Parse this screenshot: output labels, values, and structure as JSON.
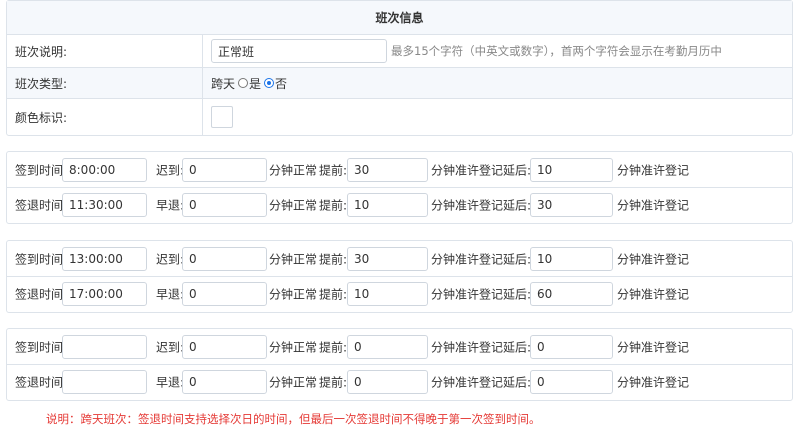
{
  "info": {
    "title": "班次信息",
    "name_label": "班次说明:",
    "name_value": "正常班",
    "name_hint": "最多15个字符（中英文或数字），首两个字符会显示在考勤月历中",
    "type_label": "班次类型:",
    "overnight_label": "跨天",
    "option_yes": "是",
    "option_no": "否",
    "selected_option": "否",
    "color_label": "颜色标识:"
  },
  "labels": {
    "checkin": "签到时间:",
    "checkout": "签退时间:",
    "late": "迟到:",
    "early": "早退:",
    "before": "提前:",
    "after": "延后:",
    "unit_normal": "分钟正常",
    "unit_allow": "分钟准许登记"
  },
  "groups": [
    {
      "checkin": {
        "time": "8:00:00",
        "minutes": "0",
        "before": "30",
        "after": "10"
      },
      "checkout": {
        "time": "11:30:00",
        "minutes": "0",
        "before": "10",
        "after": "30"
      }
    },
    {
      "checkin": {
        "time": "13:00:00",
        "minutes": "0",
        "before": "30",
        "after": "10"
      },
      "checkout": {
        "time": "17:00:00",
        "minutes": "0",
        "before": "10",
        "after": "60"
      }
    },
    {
      "checkin": {
        "time": "",
        "minutes": "0",
        "before": "0",
        "after": "0"
      },
      "checkout": {
        "time": "",
        "minutes": "0",
        "before": "0",
        "after": "0"
      }
    }
  ],
  "note": "说明：跨天班次：签退时间支持选择次日的时间，但最后一次签退时间不得晚于第一次签到时间。",
  "colors": {
    "border": "#dde3ea",
    "header_bg": "#f5f8fc",
    "radio_checked": "#1a73e8",
    "note": "#e53935"
  }
}
